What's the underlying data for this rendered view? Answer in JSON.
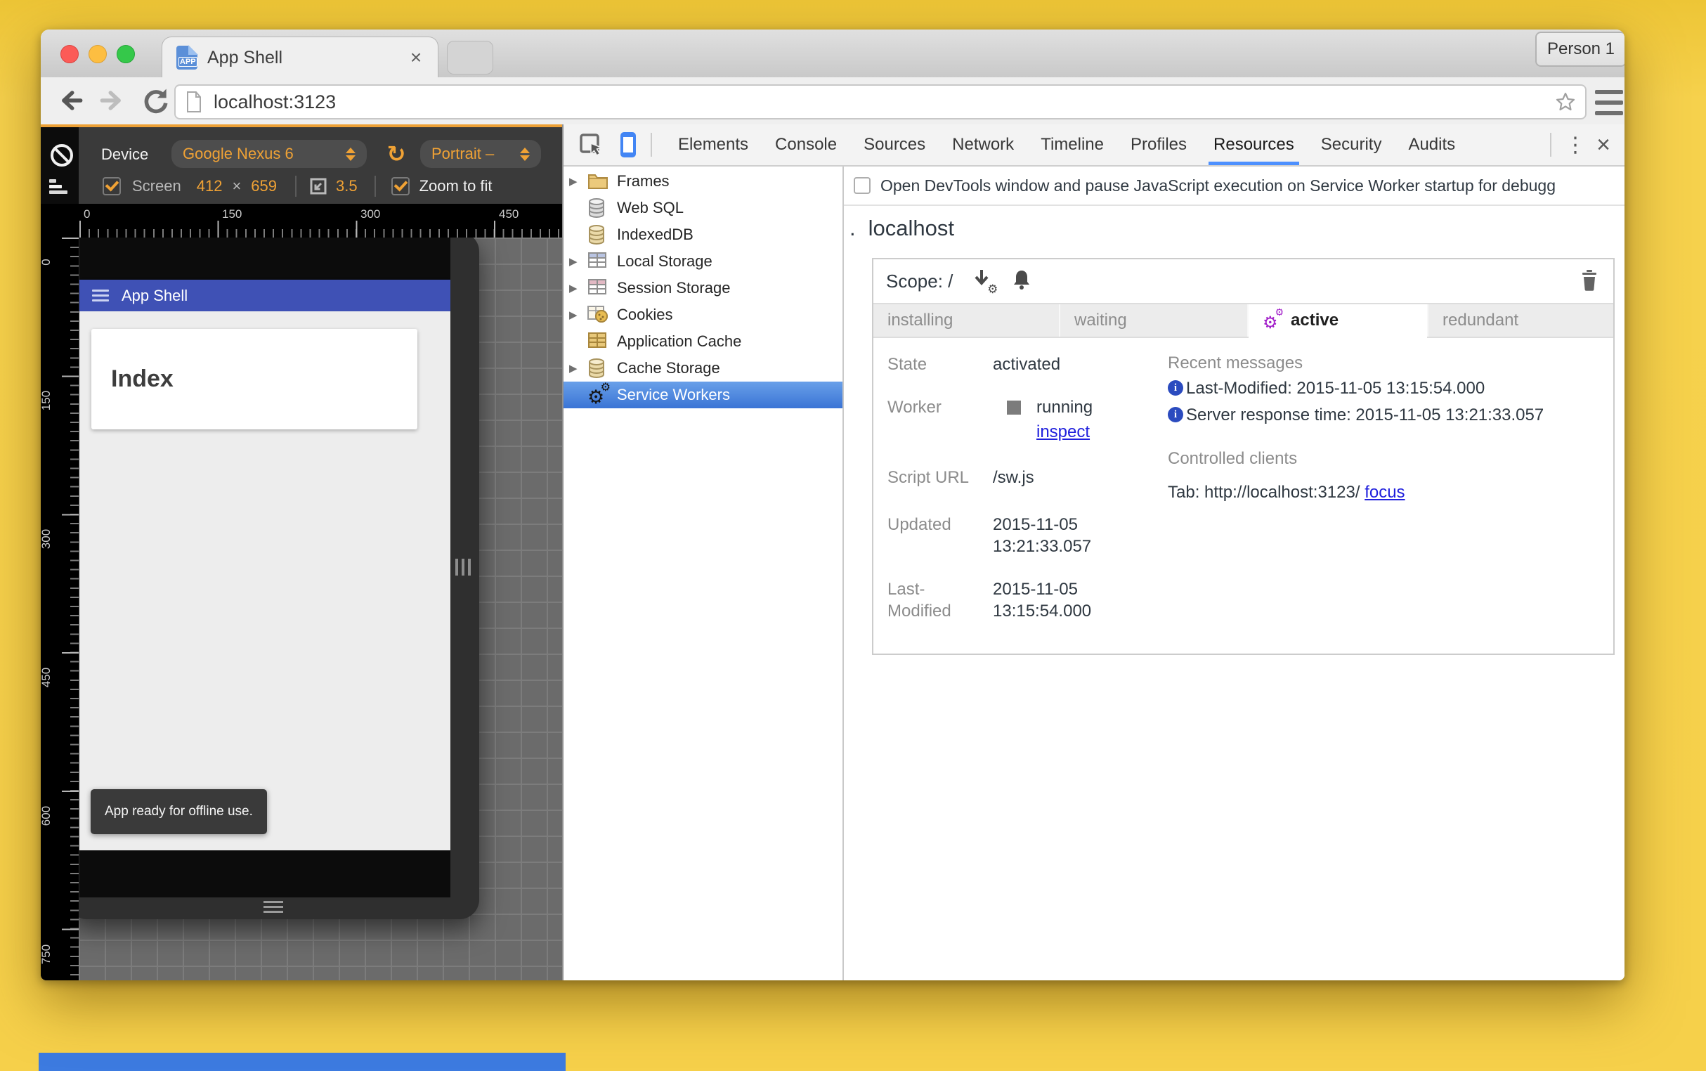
{
  "colors": {
    "desktop_yellow": "#f6d14c",
    "emulation_accent_orange": "#f0a235",
    "appbar_indigo": "#3f51b5",
    "devtools_tab_underline": "#4d90fe",
    "sidebar_selection_blue": "#3a74d5",
    "active_gear_purple": "#a21fc9",
    "link_blue": "#2020dd",
    "background_window_strip": "#3d7be0"
  },
  "chrome": {
    "tab_title": "App Shell",
    "favicon_text": "APP",
    "profile_button": "Person 1",
    "url": "localhost:3123"
  },
  "device_toolbar": {
    "device_label": "Device",
    "device_model": "Google Nexus 6",
    "orientation": "Portrait –",
    "screen_label": "Screen",
    "screen_width": "412",
    "times": "×",
    "screen_height": "659",
    "dpr": "3.5",
    "zoom_to_fit": "Zoom to fit"
  },
  "rulers": {
    "horizontal": [
      "0",
      "150",
      "300",
      "450"
    ],
    "vertical": [
      "0",
      "150",
      "300",
      "450",
      "600",
      "750"
    ]
  },
  "emulated_page": {
    "app_bar_title": "App Shell",
    "card_title": "Index",
    "toast": "App ready for offline use."
  },
  "devtools": {
    "tabs": [
      "Elements",
      "Console",
      "Sources",
      "Network",
      "Timeline",
      "Profiles",
      "Resources",
      "Security",
      "Audits"
    ],
    "selected_tab": "Resources",
    "sidebar": {
      "items": [
        {
          "label": "Frames"
        },
        {
          "label": "Web SQL"
        },
        {
          "label": "IndexedDB"
        },
        {
          "label": "Local Storage"
        },
        {
          "label": "Session Storage"
        },
        {
          "label": "Cookies"
        },
        {
          "label": "Application Cache"
        },
        {
          "label": "Cache Storage"
        },
        {
          "label": "Service Workers"
        }
      ],
      "selected": "Service Workers"
    },
    "service_workers": {
      "debug_checkbox_label": "Open DevTools window and pause JavaScript execution on Service Worker startup for debugg",
      "origin_prefix": ".",
      "origin": "localhost",
      "scope_label": "Scope: /",
      "version_tabs": [
        "installing",
        "waiting",
        "active",
        "redundant"
      ],
      "active_version_tab": "active",
      "state_label": "State",
      "state_value": "activated",
      "worker_label": "Worker",
      "worker_status": "running",
      "inspect_link": "inspect",
      "script_url_label": "Script URL",
      "script_url_value": "/sw.js",
      "updated_label": "Updated",
      "updated_value": "2015-11-05 13:21:33.057",
      "last_modified_label": "Last-Modified",
      "last_modified_value": "2015-11-05 13:15:54.000",
      "recent_messages_title": "Recent messages",
      "recent_messages": [
        "Last-Modified: 2015-11-05 13:15:54.000",
        "Server response time: 2015-11-05 13:21:33.057"
      ],
      "controlled_clients_title": "Controlled clients",
      "controlled_client": "Tab: http://localhost:3123/",
      "focus_link": "focus"
    }
  }
}
